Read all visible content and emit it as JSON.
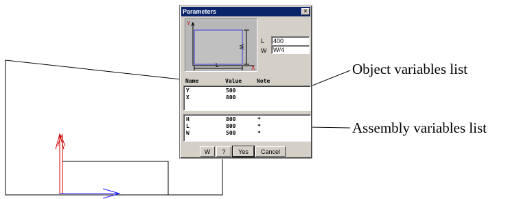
{
  "dialog": {
    "title": "Parameters",
    "close_glyph": "✕",
    "preview": {
      "dim_l": "L",
      "dim_w": "W",
      "axis_y": "Y",
      "axis_x": "X"
    },
    "params": [
      {
        "label": "L",
        "value": "400"
      },
      {
        "label": "W",
        "value": "W/4"
      }
    ],
    "columns": {
      "name": "Name",
      "value": "Value",
      "note": "Note"
    },
    "object_variables": [
      {
        "name": "Y",
        "value": "500",
        "note": ""
      },
      {
        "name": "X",
        "value": "800",
        "note": ""
      }
    ],
    "assembly_variables": [
      {
        "name": "H",
        "value": "800",
        "note": "*"
      },
      {
        "name": "L",
        "value": "800",
        "note": "*"
      },
      {
        "name": "W",
        "value": "500",
        "note": "*"
      }
    ],
    "buttons": {
      "w": "W",
      "help": "?",
      "yes": "Yes",
      "cancel": "Cancel"
    }
  },
  "callouts": {
    "object": "Object variables list",
    "assembly": "Assembly variables list"
  },
  "colors": {
    "titlebar": "#0a246a",
    "dialog_face": "#d4d0c8",
    "preview_bg": "#b8b8b8",
    "preview_rect": "#3c3cd8",
    "axis_y": "#d00000",
    "axis_x": "#1a1aff",
    "drawing_line": "#000000"
  }
}
